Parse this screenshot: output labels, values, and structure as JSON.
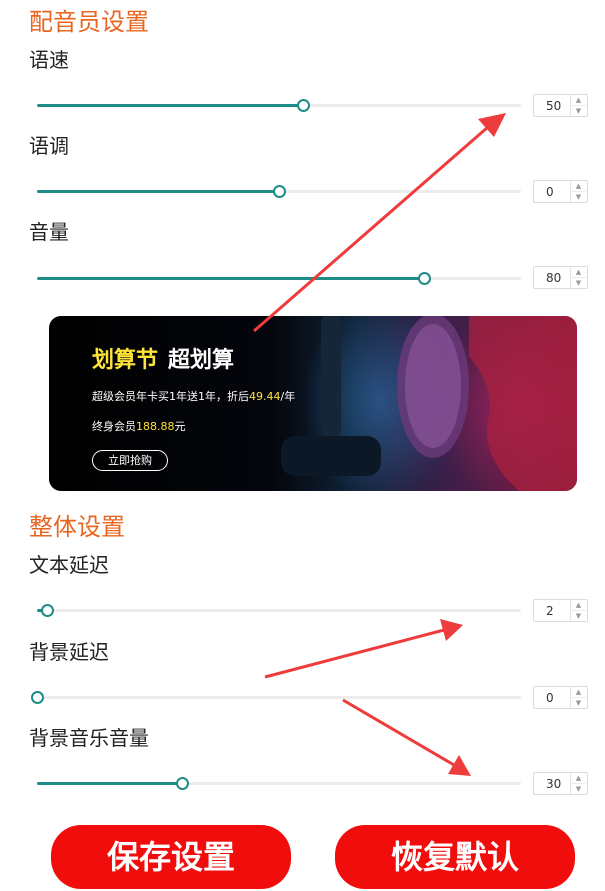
{
  "voice_section": {
    "title": "配音员设置",
    "rows": [
      {
        "label": "语速",
        "value": "50",
        "fraction": 0.55
      },
      {
        "label": "语调",
        "value": "0",
        "fraction": 0.5
      },
      {
        "label": "音量",
        "value": "80",
        "fraction": 0.8
      }
    ]
  },
  "banner": {
    "title_highlight": "划算节",
    "title_rest": "超划算",
    "line1_prefix": "超级会员年卡买1年送1年，折后",
    "line1_price": "49.44",
    "line1_suffix": "/年",
    "line2_prefix": "终身会员",
    "line2_price": "188.88",
    "line2_suffix": "元",
    "button_label": "立即抢购"
  },
  "overall_section": {
    "title": "整体设置",
    "rows": [
      {
        "label": "文本延迟",
        "value": "2",
        "fraction": 0.02
      },
      {
        "label": "背景延迟",
        "value": "0",
        "fraction": 0.0
      },
      {
        "label": "背景音乐音量",
        "value": "30",
        "fraction": 0.3
      }
    ]
  },
  "buttons": {
    "save_label": "保存设置",
    "reset_label": "恢复默认"
  },
  "colors": {
    "section_title": "#e8651f",
    "slider_accent": "#1d8c86",
    "button_red": "#f20d0d",
    "annotation_arrow": "#ee3b3b",
    "banner_highlight": "#ffe338"
  },
  "icons": [
    "spin-up-icon",
    "spin-down-icon",
    "annotation-arrow"
  ]
}
